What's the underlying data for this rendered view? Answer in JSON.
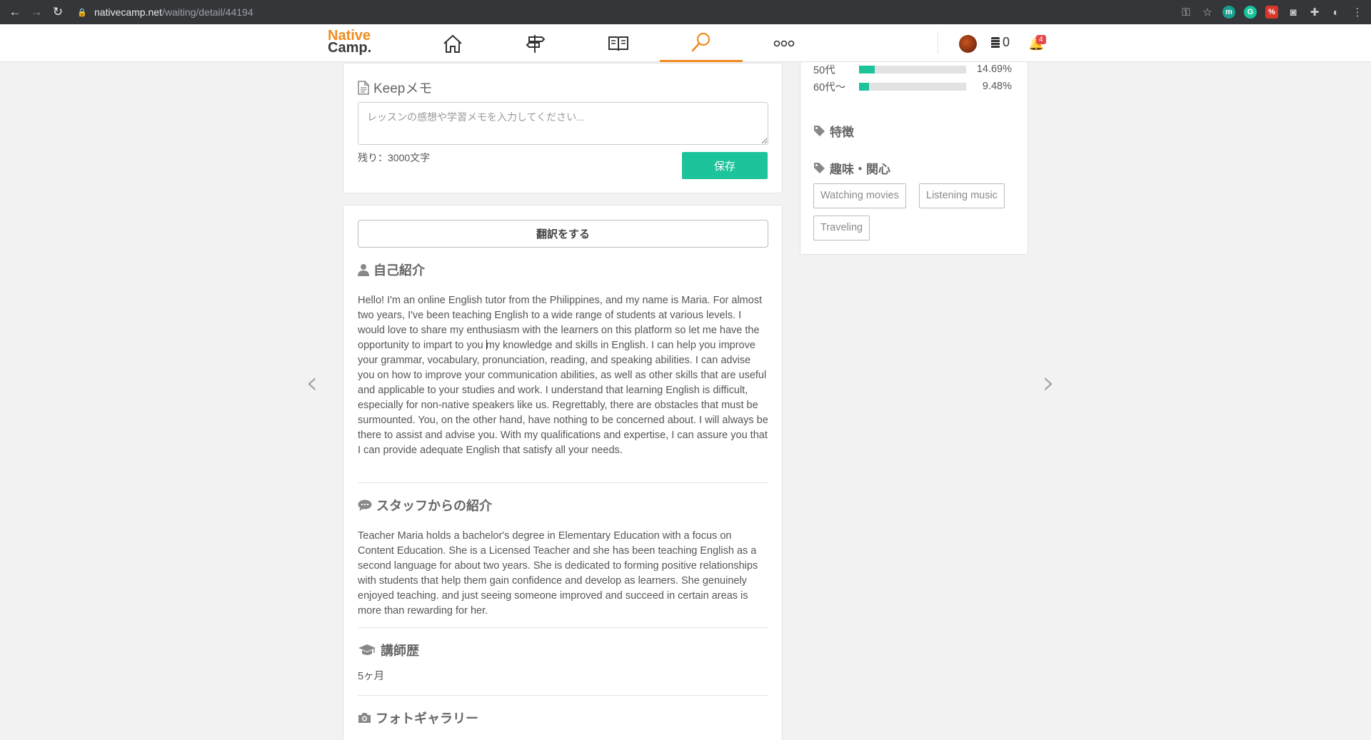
{
  "browser": {
    "url_host": "nativecamp.net",
    "url_path": "/waiting/detail/44194"
  },
  "header": {
    "logo_line1": "Native",
    "logo_line2": "Camp.",
    "coins": "0",
    "notification_count": "4",
    "nav": [
      {
        "icon": "home-icon"
      },
      {
        "icon": "signpost-icon"
      },
      {
        "icon": "book-icon"
      },
      {
        "icon": "search-icon",
        "active": true
      },
      {
        "icon": "more-icon"
      }
    ]
  },
  "memo": {
    "title": "Keepメモ",
    "placeholder": "レッスンの感想や学習メモを入力してください...",
    "remaining": "残り：3000文字",
    "save_label": "保存"
  },
  "intro": {
    "translate_label": "翻訳をする",
    "self_intro_title": "自己紹介",
    "self_intro_text": "Hello! I'm an online English tutor from the Philippines, and my name is Maria. For almost two years, I've been teaching English to a wide range of students at various levels. I would love to share my enthusiasm with the learners on this platform so let me have the opportunity to impart to you my knowledge and skills in English. I can help you improve your grammar, vocabulary, pronunciation, reading, and speaking abilities. I can advise you on how to improve your communication abilities, as well as other skills that are useful and applicable to your studies and work. I understand that learning English is difficult, especially for non-native speakers like us. Regrettably, there are obstacles that must be surmounted. You, on the other hand, have nothing to be concerned about. I will always be there to assist and advise you. With my qualifications and expertise, I can assure you that I can provide adequate English that satisfy all your needs.",
    "staff_intro_title": "スタッフからの紹介",
    "staff_intro_text": "Teacher Maria holds a bachelor's degree in Elementary Education with a focus on Content Education. She is a Licensed Teacher and she has been teaching English as a second language for about two years. She is dedicated to forming positive relationships with students that help them gain confidence and develop as learners. She genuinely enjoyed teaching. and just seeing someone improved and succeed in certain areas is more than rewarding for her.",
    "history_title": "講師歴",
    "history_value": "5ヶ月",
    "gallery_title": "フォトギャラリー"
  },
  "sidebar": {
    "age_rows": [
      {
        "label": "50代",
        "percent": "14.69%",
        "fraction": 0.1469
      },
      {
        "label": "60代〜",
        "percent": "9.48%",
        "fraction": 0.0948
      }
    ],
    "features_title": "特徴",
    "interests_title": "趣味・関心",
    "tags": [
      "Watching movies",
      "Listening music",
      "Traveling"
    ]
  },
  "colors": {
    "accent": "#1cc39b",
    "brand_orange": "#f08c1e"
  }
}
